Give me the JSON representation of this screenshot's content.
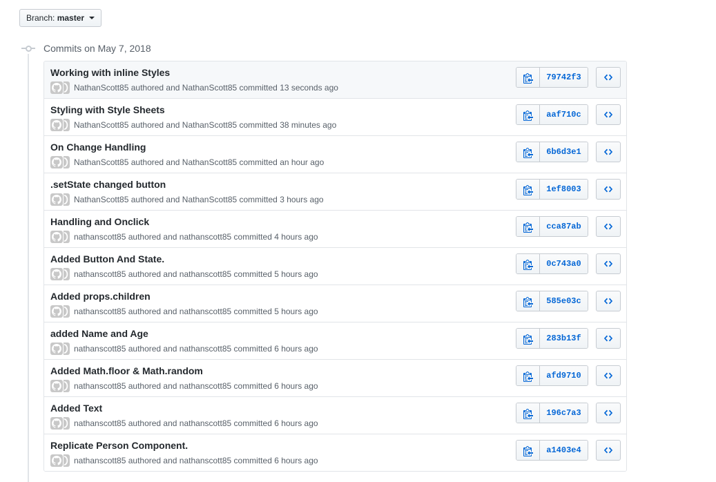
{
  "branch": {
    "prefix": "Branch:",
    "name": "master"
  },
  "timeline": {
    "heading": "Commits on May 7, 2018"
  },
  "colors": {
    "link": "#0366d6",
    "text": "#24292e",
    "muted": "#586069",
    "border": "#e1e4e8"
  },
  "icons": {
    "copy": "clippy-icon",
    "browse": "code-icon",
    "avatar": "github-octocat-avatar-icon",
    "commit_node": "git-commit-icon",
    "caret": "caret-down-icon"
  },
  "commits": [
    {
      "title": "Working with inline Styles",
      "meta": "NathanScott85 authored and NathanScott85 committed 13 seconds ago",
      "sha": "79742f3"
    },
    {
      "title": "Styling with Style Sheets",
      "meta": "NathanScott85 authored and NathanScott85 committed 38 minutes ago",
      "sha": "aaf710c"
    },
    {
      "title": "On Change Handling",
      "meta": "NathanScott85 authored and NathanScott85 committed an hour ago",
      "sha": "6b6d3e1"
    },
    {
      "title": ".setState changed button",
      "meta": "NathanScott85 authored and NathanScott85 committed 3 hours ago",
      "sha": "1ef8003"
    },
    {
      "title": "Handling and Onclick",
      "meta": "nathanscott85 authored and nathanscott85 committed 4 hours ago",
      "sha": "cca87ab"
    },
    {
      "title": "Added Button And State.",
      "meta": "nathanscott85 authored and nathanscott85 committed 5 hours ago",
      "sha": "0c743a0"
    },
    {
      "title": "Added props.children",
      "meta": "nathanscott85 authored and nathanscott85 committed 5 hours ago",
      "sha": "585e03c"
    },
    {
      "title": "added Name and Age",
      "meta": "nathanscott85 authored and nathanscott85 committed 6 hours ago",
      "sha": "283b13f"
    },
    {
      "title": "Added Math.floor & Math.random",
      "meta": "nathanscott85 authored and nathanscott85 committed 6 hours ago",
      "sha": "afd9710"
    },
    {
      "title": "Added Text",
      "meta": "nathanscott85 authored and nathanscott85 committed 6 hours ago",
      "sha": "196c7a3"
    },
    {
      "title": "Replicate Person Component.",
      "meta": "nathanscott85 authored and nathanscott85 committed 6 hours ago",
      "sha": "a1403e4"
    }
  ]
}
